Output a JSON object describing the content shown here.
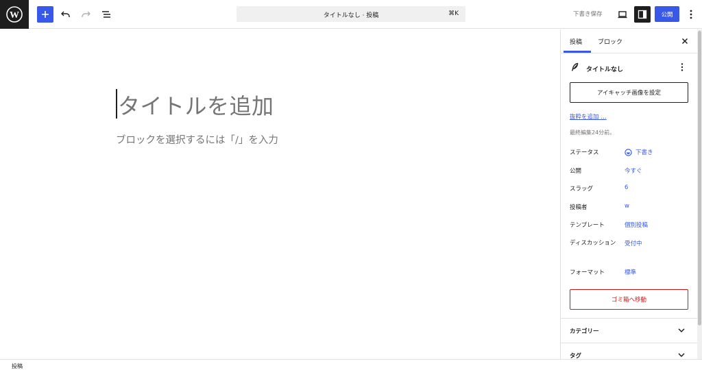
{
  "topbar": {
    "logo_icon": "wordpress-logo-icon",
    "add_icon": "plus-icon",
    "undo_icon": "undo-icon",
    "redo_icon": "redo-icon",
    "outline_icon": "list-view-icon",
    "command_title": "タイトルなし · 投稿",
    "command_shortcut": "⌘K",
    "save_draft": "下書き保存",
    "preview_icon": "desktop-icon",
    "settings_icon": "sidebar-toggle-icon",
    "publish": "公開",
    "more_icon": "more-vertical-icon"
  },
  "editor": {
    "title_placeholder": "タイトルを追加",
    "block_hint": "ブロックを選択するには「/」を入力"
  },
  "sidebar": {
    "tabs": [
      {
        "label": "投稿",
        "active": true
      },
      {
        "label": "ブロック",
        "active": false
      }
    ],
    "post_card": {
      "icon": "post-feather-icon",
      "title": "タイトルなし"
    },
    "featured_image_button": "アイキャッチ画像を設定",
    "excerpt_link": "抜粋を追加 …",
    "last_edited": "最終編集24分前。",
    "rows": [
      {
        "label": "ステータス",
        "value": "下書き"
      },
      {
        "label": "公開",
        "value": "今すぐ"
      },
      {
        "label": "スラッグ",
        "value": "6"
      },
      {
        "label": "投稿者",
        "value": "w"
      },
      {
        "label": "テンプレート",
        "value": "個別投稿"
      },
      {
        "label": "ディスカッション",
        "value": "受付中"
      },
      {
        "label": "フォーマット",
        "value": "標準"
      }
    ],
    "trash_button": "ゴミ箱へ移動",
    "panels": [
      {
        "title": "カテゴリー"
      },
      {
        "title": "タグ"
      }
    ]
  },
  "footer": {
    "breadcrumb": "投稿"
  },
  "colors": {
    "accent": "#3858e9",
    "danger": "#cc1818",
    "dark": "#1e1e1e",
    "muted": "#757575"
  }
}
